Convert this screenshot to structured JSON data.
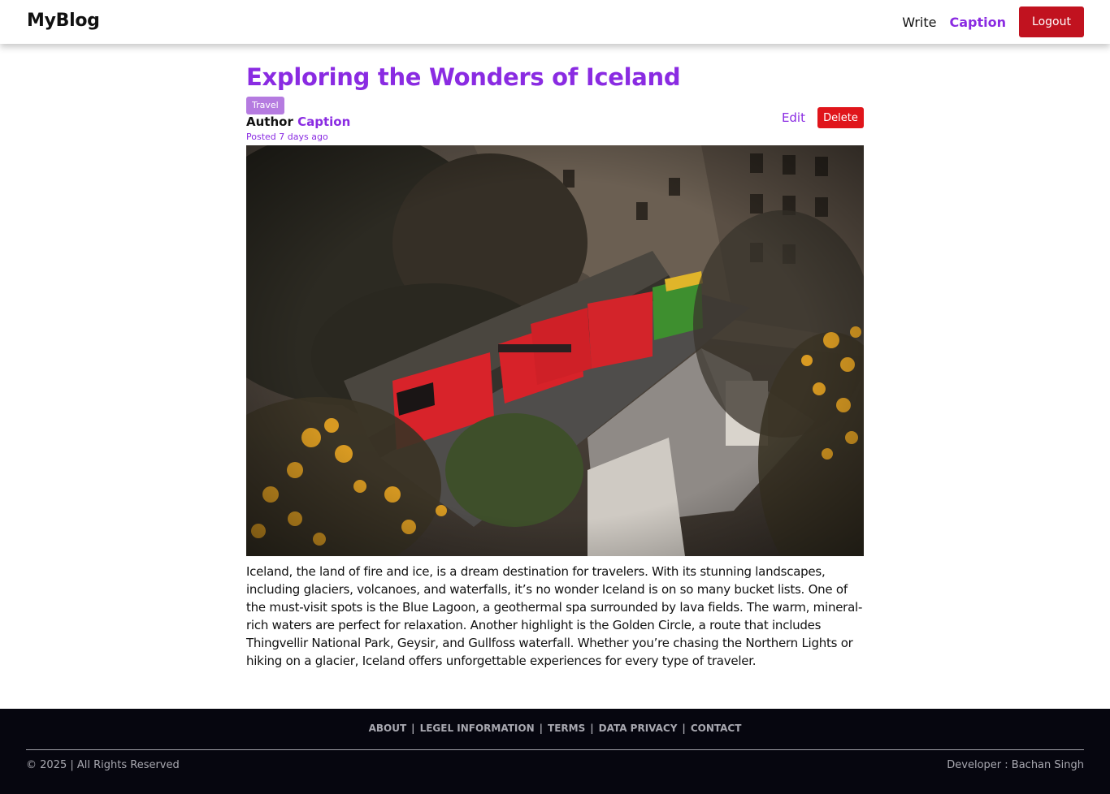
{
  "navbar": {
    "brand": "MyBlog",
    "write_label": "Write",
    "user_label": "Caption",
    "logout_label": "Logout"
  },
  "post": {
    "title": "Exploring the Wonders of Iceland",
    "category": "Travel",
    "author_prefix": "Author",
    "author_name": "Caption",
    "posted": "Posted 7 days ago",
    "edit_label": "Edit",
    "delete_label": "Delete",
    "image_description": "",
    "body": "Iceland, the land of fire and ice, is a dream destination for travelers. With its stunning landscapes, including glaciers, volcanoes, and waterfalls, it’s no wonder Iceland is on so many bucket lists. One of the must-visit spots is the Blue Lagoon, a geothermal spa surrounded by lava fields. The warm, mineral-rich waters are perfect for relaxation. Another highlight is the Golden Circle, a route that includes Thingvellir National Park, Geysir, and Gullfoss waterfall. Whether you’re chasing the Northern Lights or hiking on a glacier, Iceland offers unforgettable experiences for every type of traveler."
  },
  "footer": {
    "links": [
      "ABOUT",
      "LEGEL INFORMATION",
      "TERMS",
      "DATA PRIVACY",
      "CONTACT"
    ],
    "separator": "|",
    "copyright": "© 2025 | All Rights Reserved",
    "developer": "Developer : Bachan Singh"
  },
  "colors": {
    "accent": "#8a2be2",
    "logout": "#c1121f",
    "delete": "#e0151b",
    "tag": "#b57be0",
    "footer_bg": "#06060f"
  }
}
